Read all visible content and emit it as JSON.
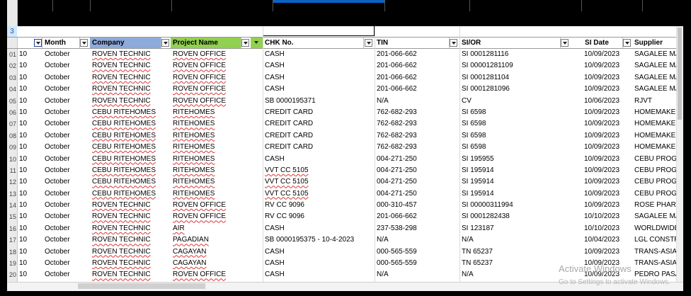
{
  "headers": {
    "month": "Month",
    "company": "Company",
    "project": "Project Name",
    "chk": "CHK No.",
    "tin": "TIN",
    "sior": "SI/OR",
    "sidate": "SI Date",
    "supplier": "Supplier"
  },
  "colors": {
    "company_header": "#8eaadb",
    "project_header": "#92d050"
  },
  "row3_label": "3",
  "rows": [
    {
      "n": "01",
      "a": "10",
      "month": "October",
      "company": "ROVEN TECHNIC",
      "project": "ROVEN OFFICE",
      "chk": "CASH",
      "tin": "201-066-662",
      "sior": "SI 0001281116",
      "date": "10/09/2023",
      "supplier": "SAGALEE MAN"
    },
    {
      "n": "02",
      "a": "10",
      "month": "October",
      "company": "ROVEN TECHNIC",
      "project": "ROVEN OFFICE",
      "chk": "CASH",
      "tin": "201-066-662",
      "sior": "SI 00001281109",
      "date": "10/09/2023",
      "supplier": "SAGALEE MAN"
    },
    {
      "n": "03",
      "a": "10",
      "month": "October",
      "company": "ROVEN TECHNIC",
      "project": "ROVEN OFFICE",
      "chk": "CASH",
      "tin": "201-066-662",
      "sior": "SI 0001281104",
      "date": "10/09/2023",
      "supplier": "SAGALEE MAN"
    },
    {
      "n": "04",
      "a": "10",
      "month": "October",
      "company": "ROVEN TECHNIC",
      "project": "ROVEN OFFICE",
      "chk": "CASH",
      "tin": "201-066-662",
      "sior": "SI 0001281096",
      "date": "10/09/2023",
      "supplier": "SAGALEE MAN"
    },
    {
      "n": "05",
      "a": "10",
      "month": "October",
      "company": "ROVEN TECHNIC",
      "project": "ROVEN OFFICE",
      "chk": "SB 0000195371",
      "tin": "N/A",
      "sior": "CV",
      "date": "10/06/2023",
      "supplier": "RJVT"
    },
    {
      "n": "06",
      "a": "10",
      "month": "October",
      "company": "CEBU RITEHOMES",
      "project": "RITEHOMES",
      "chk": "CREDIT CARD",
      "tin": "762-682-293",
      "sior": "SI 6598",
      "date": "10/09/2023",
      "supplier": "HOMEMAKER"
    },
    {
      "n": "07",
      "a": "10",
      "month": "October",
      "company": "CEBU RITEHOMES",
      "project": "RITEHOMES",
      "chk": "CREDIT CARD",
      "tin": "762-682-293",
      "sior": "SI 6598",
      "date": "10/09/2023",
      "supplier": "HOMEMAKER"
    },
    {
      "n": "08",
      "a": "10",
      "month": "October",
      "company": "CEBU RITEHOMES",
      "project": "RITEHOMES",
      "chk": "CREDIT CARD",
      "tin": "762-682-293",
      "sior": "SI 6598",
      "date": "10/09/2023",
      "supplier": "HOMEMAKER"
    },
    {
      "n": "09",
      "a": "10",
      "month": "October",
      "company": "CEBU RITEHOMES",
      "project": "RITEHOMES",
      "chk": "CREDIT CARD",
      "tin": "762-682-293",
      "sior": "SI 6598",
      "date": "10/09/2023",
      "supplier": "HOMEMAKER"
    },
    {
      "n": "10",
      "a": "10",
      "month": "October",
      "company": "CEBU RITEHOMES",
      "project": "RITEHOMES",
      "chk": "CASH",
      "tin": "004-271-250",
      "sior": "SI 195955",
      "date": "10/09/2023",
      "supplier": "CEBU PROGRE"
    },
    {
      "n": "11",
      "a": "10",
      "month": "October",
      "company": "CEBU RITEHOMES",
      "project": "RITEHOMES",
      "chk": "VVT CC 5105",
      "tin": "004-271-250",
      "sior": "SI 195914",
      "date": "10/09/2023",
      "supplier": "CEBU PROGRE"
    },
    {
      "n": "12",
      "a": "10",
      "month": "October",
      "company": "CEBU RITEHOMES",
      "project": "RITEHOMES",
      "chk": "VVT CC 5105",
      "tin": "004-271-250",
      "sior": "SI 195914",
      "date": "10/09/2023",
      "supplier": "CEBU PROGRE"
    },
    {
      "n": "13",
      "a": "10",
      "month": "October",
      "company": "CEBU RITEHOMES",
      "project": "RITEHOMES",
      "chk": "VVT CC 5105",
      "tin": "004-271-250",
      "sior": "SI 195914",
      "date": "10/09/2023",
      "supplier": "CEBU PROGRE"
    },
    {
      "n": "14",
      "a": "10",
      "month": "October",
      "company": "ROVEN TECHNIC",
      "project": "ROVEN OFFICE",
      "chk": "RV CC 9096",
      "tin": "000-310-457",
      "sior": "SI 00000311994",
      "date": "10/09/2023",
      "supplier": "ROSE PHARMA"
    },
    {
      "n": "15",
      "a": "10",
      "month": "October",
      "company": "ROVEN TECHNIC",
      "project": "ROVEN OFFICE",
      "chk": "RV CC 9096",
      "tin": "201-066-662",
      "sior": "SI 0001282438",
      "date": "10/10/2023",
      "supplier": "SAGALEE MAN"
    },
    {
      "n": "16",
      "a": "10",
      "month": "October",
      "company": "ROVEN TECHNIC",
      "project": "AIR",
      "chk": "CASH",
      "tin": "237-538-298",
      "sior": "SI 123187",
      "date": "10/10/2023",
      "supplier": "WORLDWIDE I"
    },
    {
      "n": "17",
      "a": "10",
      "month": "October",
      "company": "ROVEN TECHNIC",
      "project": "PAGADIAN",
      "chk": "SB 0000195375 - 10-4-2023",
      "tin": "N/A",
      "sior": "N/A",
      "date": "10/04/2023",
      "supplier": "LGL CONSTRU"
    },
    {
      "n": "18",
      "a": "10",
      "month": "October",
      "company": "ROVEN TECHNIC",
      "project": "CAGAYAN",
      "chk": "CASH",
      "tin": "000-565-559",
      "sior": "TN 65237",
      "date": "10/09/2023",
      "supplier": "TRANS-ASIA SH"
    },
    {
      "n": "19",
      "a": "10",
      "month": "October",
      "company": "ROVEN TECHNIC",
      "project": "CAGAYAN",
      "chk": "CASH",
      "tin": "000-565-559",
      "sior": "TN 65237",
      "date": "10/09/2023",
      "supplier": "TRANS-ASIA SH"
    },
    {
      "n": "20",
      "a": "10",
      "month": "October",
      "company": "ROVEN TECHNIC",
      "project": "ROVEN OFFICE",
      "chk": "CASH",
      "tin": "N/A",
      "sior": "N/A",
      "date": "10/09/2023",
      "supplier": "PEDRO PASAS"
    }
  ],
  "watermark": {
    "title": "Activate Windows",
    "subtitle": "Go to Settings to activate Windows."
  }
}
